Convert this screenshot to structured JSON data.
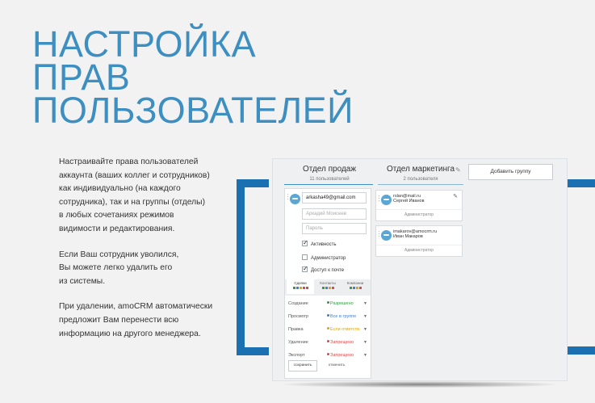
{
  "headline": [
    "НАСТРОЙКА",
    "ПРАВ",
    "ПОЛЬЗОВАТЕЛЕЙ"
  ],
  "paragraphs": [
    "Настраивайте права пользователей\nаккаунта (ваших коллег и сотрудников)\nкак индивидуально (на каждого\nсотрудника), так и на группы (отделы)\nв любых сочетаниях режимов\nвидимости и редактирования.",
    "Если Ваш сотрудник уволился,\nВы можете легко удалить его\nиз системы.",
    "При удалении, amoCRM автоматически\nпредложит Вам перенести всю\nинформацию на другого менеджера."
  ],
  "colors": {
    "accent": "#3d8fc1",
    "frame": "#1a70b0",
    "allowed": "#2e9e3e",
    "group": "#3d7fd8",
    "own": "#e4a400",
    "forbidden": "#e04848"
  },
  "groups": [
    {
      "name": "Отдел продаж",
      "count": "11 пользователей"
    },
    {
      "name": "Отдел маркетинга",
      "count": "2 пользователя"
    }
  ],
  "add_group_label": "Добавить группу",
  "user_form": {
    "email_value": "arkasha49@gmail.com",
    "name_placeholder": "Аркадий Моисеев",
    "password_placeholder": "Пароль",
    "checks": [
      {
        "label": "Активность",
        "checked": true
      },
      {
        "label": "Администратор",
        "checked": false
      },
      {
        "label": "Доступ к почте",
        "checked": true
      }
    ],
    "tabs": [
      "Сделки",
      "Контакты",
      "Компании"
    ],
    "permissions": [
      {
        "label": "Создание",
        "value": "Разрешено",
        "color": "#2e9e3e"
      },
      {
        "label": "Просмотр",
        "value": "Все в группе",
        "color": "#3d7fd8"
      },
      {
        "label": "Правка",
        "value": "Если ответств.",
        "color": "#e4a400"
      },
      {
        "label": "Удаление",
        "value": "Запрещено",
        "color": "#e04848"
      },
      {
        "label": "Экспорт",
        "value": "Запрещено",
        "color": "#e04848"
      }
    ],
    "save_label": "сохранить",
    "cancel_label": "отменить"
  },
  "members": [
    {
      "email": "rslan@mail.ru",
      "name": "Сергей Иванов",
      "role": "Администратор"
    },
    {
      "email": "imakarov@amocrm.ru",
      "name": "Иван Макаров",
      "role": "Администратор"
    }
  ]
}
